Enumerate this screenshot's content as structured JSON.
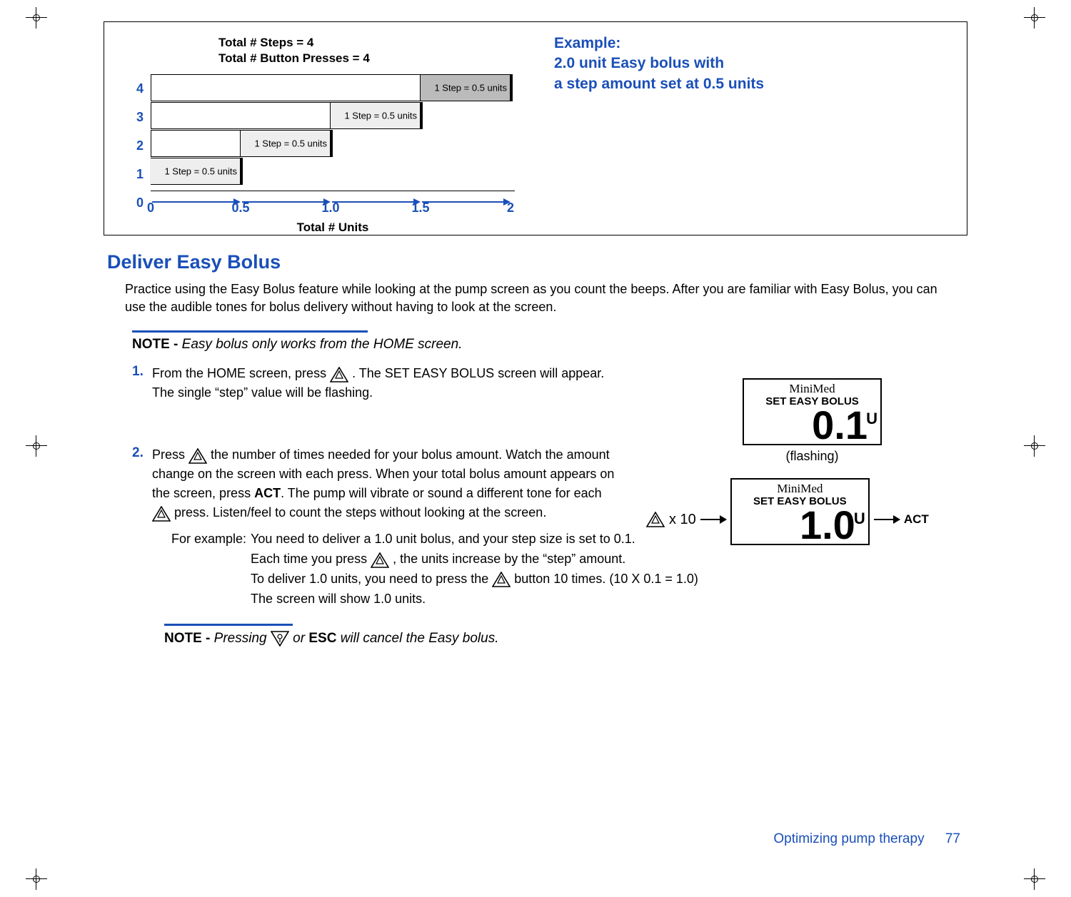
{
  "chart_data": {
    "type": "bar",
    "title_lines": [
      "Total # Steps = 4",
      "Total # Button Presses = 4"
    ],
    "xlabel": "Total # Units",
    "x_ticks": [
      "0",
      "0.5",
      "1.0",
      "1.5",
      "2"
    ],
    "y_ticks": [
      "4",
      "3",
      "2",
      "1",
      "0"
    ],
    "bar_annotation": "1 Step = 0.5 units",
    "series": [
      {
        "name": "Step 1",
        "cumulative_units": 0.5
      },
      {
        "name": "Step 2",
        "cumulative_units": 1.0
      },
      {
        "name": "Step 3",
        "cumulative_units": 1.5
      },
      {
        "name": "Step 4",
        "cumulative_units": 2.0
      }
    ]
  },
  "example": {
    "label": "Example:",
    "line1": "2.0 unit Easy bolus with",
    "line2": "a step amount set at 0.5 units"
  },
  "section_title": "Deliver Easy Bolus",
  "intro": "Practice using the Easy Bolus feature while looking at the pump screen as you count the beeps. After you are familiar with Easy Bolus, you can use the audible tones for bolus delivery without having to look at the screen.",
  "note1_label": "NOTE - ",
  "note1_text": "Easy bolus only works from the HOME screen.",
  "step1": {
    "num": "1.",
    "a": "From the HOME screen, press ",
    "b": ". The SET EASY BOLUS screen will appear. The single “step” value will be flashing."
  },
  "screen1": {
    "brand": "MiniMed",
    "title": "SET EASY BOLUS",
    "value": "0.1",
    "unit": "U",
    "caption": "(flashing)"
  },
  "step2": {
    "num": "2.",
    "a": "Press ",
    "b": " the number of times needed for your bolus amount. Watch the amount change on the screen with each press. When your total bolus amount appears on the screen, press ",
    "act": "ACT",
    "c": ". The pump will vibrate or sound a different tone for each ",
    "d": " press. Listen/feel to count the steps without looking at the screen."
  },
  "step2_side": {
    "x10": "x 10",
    "act": "ACT"
  },
  "screen2": {
    "brand": "MiniMed",
    "title": "SET EASY BOLUS",
    "value": "1.0",
    "unit": "U"
  },
  "example_block": {
    "lead": "For example:",
    "l1a": "You need to deliver a 1.0 unit bolus, and your step size is set to 0.1.",
    "l2a": "Each time you press ",
    "l2b": ", the units increase by the “step” amount.",
    "l3a": "To deliver 1.0 units, you need to press the ",
    "l3b": " button 10 times. (10 X 0.1 = 1.0)",
    "l4": "The screen will show 1.0 units."
  },
  "note2_label": "NOTE - ",
  "note2_a": "Pressing ",
  "note2_b": " or ",
  "note2_esc": "ESC",
  "note2_c": " will cancel the Easy bolus.",
  "footer": {
    "chapter": "Optimizing pump therapy",
    "page": "77"
  }
}
